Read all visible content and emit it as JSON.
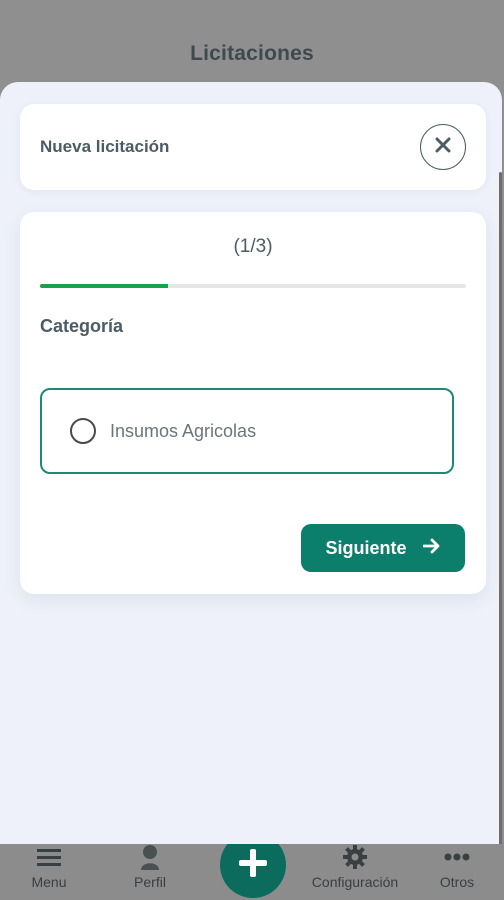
{
  "app": {
    "title": "Licitaciones"
  },
  "modal": {
    "title": "Nueva licitación",
    "step_text": "(1/3)",
    "progress_fraction": 0.3,
    "section_label": "Categoría",
    "options": [
      {
        "label": "Insumos Agricolas",
        "selected": false
      }
    ],
    "next_label": "Siguiente"
  },
  "bottom_nav": {
    "items": [
      {
        "label": "Menu",
        "icon": "menu-icon"
      },
      {
        "label": "Perfil",
        "icon": "user-icon"
      },
      {
        "label": "Configuración",
        "icon": "gear-icon"
      },
      {
        "label": "Otros",
        "icon": "more-dots-icon"
      }
    ],
    "fab_icon": "plus-icon"
  },
  "colors": {
    "accent": "#0b7f6b",
    "progress": "#16a34a",
    "option_border": "#1d8a78",
    "sheet_bg": "#eef1f9",
    "overlay": "#8f8f8f"
  }
}
